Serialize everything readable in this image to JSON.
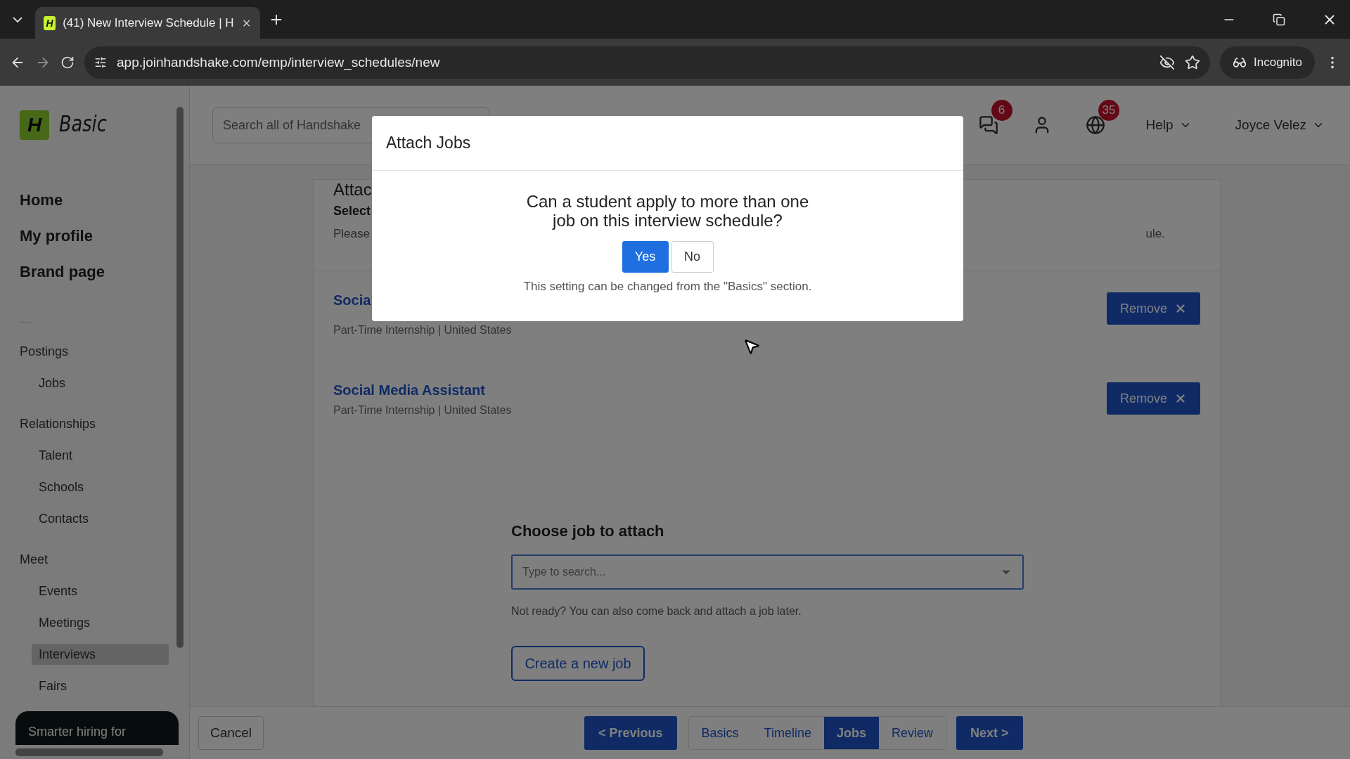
{
  "browser": {
    "favicon": "H",
    "tab_title": "(41) New Interview Schedule | H",
    "url": "app.joinhandshake.com/emp/interview_schedules/new",
    "profile": "Incognito"
  },
  "sidebar": {
    "logo_mark": "H",
    "logo_text": "Basic",
    "main_items": [
      "Home",
      "My profile",
      "Brand page"
    ],
    "sections": [
      {
        "title": "Postings",
        "items": [
          {
            "label": "Jobs",
            "selected": false
          }
        ]
      },
      {
        "title": "Relationships",
        "items": [
          {
            "label": "Talent",
            "selected": false
          },
          {
            "label": "Schools",
            "selected": false
          },
          {
            "label": "Contacts",
            "selected": false
          }
        ]
      },
      {
        "title": "Meet",
        "items": [
          {
            "label": "Events",
            "selected": false
          },
          {
            "label": "Meetings",
            "selected": false
          },
          {
            "label": "Interviews",
            "selected": true
          },
          {
            "label": "Fairs",
            "selected": false
          }
        ]
      }
    ],
    "promo": "Smarter hiring for"
  },
  "header": {
    "search_placeholder": "Search all of Handshake",
    "messages_badge": "6",
    "notifications_badge": "35",
    "help": "Help",
    "user": "Joyce Velez"
  },
  "section": {
    "title": "Attac",
    "subtitle": "Select",
    "note_start": "Please",
    "note_end": "ule."
  },
  "jobs": [
    {
      "title": "Socia",
      "meta": "Part-Time Internship | United States",
      "action": "Remove"
    },
    {
      "title": "Social Media Assistant",
      "meta": "Part-Time Internship | United States",
      "action": "Remove"
    }
  ],
  "attach": {
    "heading": "Choose job to attach",
    "placeholder": "Type to search...",
    "hint": "Not ready? You can also come back and attach a job later.",
    "create": "Create a new job"
  },
  "footer": {
    "cancel": "Cancel",
    "previous": "< Previous",
    "next": "Next >",
    "steps": [
      {
        "label": "Basics",
        "selected": false
      },
      {
        "label": "Timeline",
        "selected": false
      },
      {
        "label": "Jobs",
        "selected": true
      },
      {
        "label": "Review",
        "selected": false
      }
    ]
  },
  "modal": {
    "title": "Attach Jobs",
    "question": "Can a student apply to more than one job on this interview schedule?",
    "yes": "Yes",
    "no": "No",
    "note": "This setting can be changed from the \"Basics\" section."
  }
}
